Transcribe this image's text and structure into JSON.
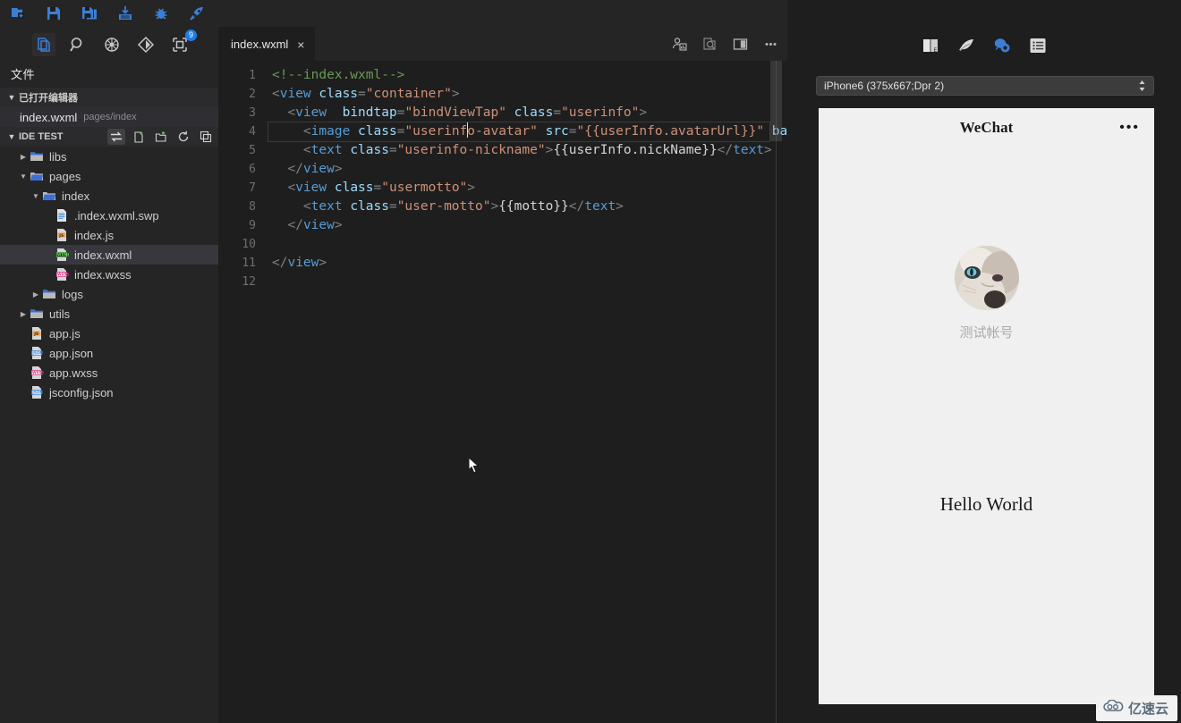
{
  "window": {
    "title_bar_icons": [
      {
        "name": "new-file-icon",
        "glyph": "new-file"
      },
      {
        "name": "save-icon",
        "glyph": "save"
      },
      {
        "name": "save-all-icon",
        "glyph": "save-all"
      },
      {
        "name": "upload-icon",
        "glyph": "upload"
      },
      {
        "name": "debug-bug-icon",
        "glyph": "bug"
      },
      {
        "name": "preview-rocket-icon",
        "glyph": "rocket"
      }
    ],
    "panel_toggles": [
      {
        "name": "toggle-left-panel",
        "state": "active"
      },
      {
        "name": "toggle-bottom-panel",
        "state": "inactive"
      },
      {
        "name": "toggle-right-panel",
        "state": "active"
      }
    ]
  },
  "activity_bar": {
    "items": [
      {
        "name": "explorer-icon",
        "label": "Explorer",
        "active": true,
        "badge": ""
      },
      {
        "name": "search-icon",
        "label": "Search",
        "active": false,
        "badge": ""
      },
      {
        "name": "debug-icon",
        "label": "Debug",
        "active": false,
        "badge": ""
      },
      {
        "name": "source-control-icon",
        "label": "Source Control",
        "active": false,
        "badge": ""
      },
      {
        "name": "extensions-icon",
        "label": "Extensions",
        "active": false,
        "badge": "9"
      }
    ]
  },
  "sidebar": {
    "title": "文件",
    "open_editors": {
      "label": "已打开编辑器",
      "expanded": true,
      "items": [
        {
          "name": "index.wxml",
          "path": "pages/index",
          "active": true
        }
      ]
    },
    "project": {
      "label": "IDE TEST",
      "expanded": true,
      "actions": [
        {
          "name": "collapse-expand-icon",
          "highlight": true
        },
        {
          "name": "new-file-icon",
          "highlight": false
        },
        {
          "name": "new-folder-icon",
          "highlight": false
        },
        {
          "name": "refresh-icon",
          "highlight": false
        },
        {
          "name": "collapse-all-icon",
          "highlight": false
        }
      ]
    },
    "tree": [
      {
        "label": "libs",
        "type": "folder",
        "indent": 1,
        "expanded": false,
        "selected": false
      },
      {
        "label": "pages",
        "type": "folder",
        "indent": 1,
        "expanded": true,
        "selected": false
      },
      {
        "label": "index",
        "type": "folder",
        "indent": 2,
        "expanded": true,
        "selected": false
      },
      {
        "label": ".index.wxml.swp",
        "type": "swp",
        "indent": 3,
        "expanded": null,
        "selected": false
      },
      {
        "label": "index.js",
        "type": "js",
        "indent": 3,
        "expanded": null,
        "selected": false
      },
      {
        "label": "index.wxml",
        "type": "wxml",
        "indent": 3,
        "expanded": null,
        "selected": true
      },
      {
        "label": "index.wxss",
        "type": "wxss",
        "indent": 3,
        "expanded": null,
        "selected": false
      },
      {
        "label": "logs",
        "type": "folder",
        "indent": 2,
        "expanded": false,
        "selected": false
      },
      {
        "label": "utils",
        "type": "folder",
        "indent": 1,
        "expanded": false,
        "selected": false
      },
      {
        "label": "app.js",
        "type": "js",
        "indent": 1,
        "expanded": null,
        "selected": false
      },
      {
        "label": "app.json",
        "type": "json",
        "indent": 1,
        "expanded": null,
        "selected": false
      },
      {
        "label": "app.wxss",
        "type": "wxss",
        "indent": 1,
        "expanded": null,
        "selected": false
      },
      {
        "label": "jsconfig.json",
        "type": "json",
        "indent": 1,
        "expanded": null,
        "selected": false
      }
    ]
  },
  "editor": {
    "tabs": [
      {
        "label": "index.wxml",
        "active": true,
        "close_label": "×"
      }
    ],
    "actions": [
      {
        "name": "compile-preview-icon"
      },
      {
        "name": "search-in-file-icon"
      },
      {
        "name": "split-editor-icon"
      },
      {
        "name": "more-actions-icon"
      }
    ],
    "line_numbers": [
      "1",
      "2",
      "3",
      "4",
      "5",
      "6",
      "7",
      "8",
      "9",
      "10",
      "11",
      "12"
    ],
    "code_lines": [
      {
        "n": 1,
        "indent": 0,
        "cursor": false,
        "tokens": [
          {
            "t": "com",
            "v": "<!--index.wxml-->"
          }
        ]
      },
      {
        "n": 2,
        "indent": 0,
        "cursor": false,
        "tokens": [
          {
            "t": "punc",
            "v": "<"
          },
          {
            "t": "tag",
            "v": "view"
          },
          {
            "t": "plain",
            "v": " "
          },
          {
            "t": "attr",
            "v": "class"
          },
          {
            "t": "punc",
            "v": "="
          },
          {
            "t": "str",
            "v": "\"container\""
          },
          {
            "t": "punc",
            "v": ">"
          }
        ]
      },
      {
        "n": 3,
        "indent": 1,
        "cursor": false,
        "tokens": [
          {
            "t": "punc",
            "v": "<"
          },
          {
            "t": "tag",
            "v": "view"
          },
          {
            "t": "plain",
            "v": "  "
          },
          {
            "t": "attr",
            "v": "bindtap"
          },
          {
            "t": "punc",
            "v": "="
          },
          {
            "t": "str",
            "v": "\"bindViewTap\""
          },
          {
            "t": "plain",
            "v": " "
          },
          {
            "t": "attr",
            "v": "class"
          },
          {
            "t": "punc",
            "v": "="
          },
          {
            "t": "str",
            "v": "\"userinfo\""
          },
          {
            "t": "punc",
            "v": ">"
          }
        ]
      },
      {
        "n": 4,
        "indent": 2,
        "cursor": true,
        "tokens": [
          {
            "t": "punc",
            "v": "<"
          },
          {
            "t": "tag",
            "v": "image"
          },
          {
            "t": "plain",
            "v": " "
          },
          {
            "t": "attr",
            "v": "class"
          },
          {
            "t": "punc",
            "v": "="
          },
          {
            "t": "str",
            "v": "\"userinf"
          },
          {
            "t": "caret",
            "v": ""
          },
          {
            "t": "str",
            "v": "o-avatar\""
          },
          {
            "t": "plain",
            "v": " "
          },
          {
            "t": "attr",
            "v": "src"
          },
          {
            "t": "punc",
            "v": "="
          },
          {
            "t": "str",
            "v": "\"{{userInfo.avatarUrl}}\""
          },
          {
            "t": "plain",
            "v": " "
          },
          {
            "t": "attr",
            "v": "bac"
          }
        ]
      },
      {
        "n": 5,
        "indent": 2,
        "cursor": false,
        "tokens": [
          {
            "t": "punc",
            "v": "<"
          },
          {
            "t": "tag",
            "v": "text"
          },
          {
            "t": "plain",
            "v": " "
          },
          {
            "t": "attr",
            "v": "class"
          },
          {
            "t": "punc",
            "v": "="
          },
          {
            "t": "str",
            "v": "\"userinfo-nickname\""
          },
          {
            "t": "punc",
            "v": ">"
          },
          {
            "t": "mus",
            "v": "{{userInfo.nickName}}"
          },
          {
            "t": "punc",
            "v": "</"
          },
          {
            "t": "tag",
            "v": "text"
          },
          {
            "t": "punc",
            "v": ">"
          }
        ]
      },
      {
        "n": 6,
        "indent": 1,
        "cursor": false,
        "tokens": [
          {
            "t": "punc",
            "v": "</"
          },
          {
            "t": "tag",
            "v": "view"
          },
          {
            "t": "punc",
            "v": ">"
          }
        ]
      },
      {
        "n": 7,
        "indent": 1,
        "cursor": false,
        "tokens": [
          {
            "t": "punc",
            "v": "<"
          },
          {
            "t": "tag",
            "v": "view"
          },
          {
            "t": "plain",
            "v": " "
          },
          {
            "t": "attr",
            "v": "class"
          },
          {
            "t": "punc",
            "v": "="
          },
          {
            "t": "str",
            "v": "\"usermotto\""
          },
          {
            "t": "punc",
            "v": ">"
          }
        ]
      },
      {
        "n": 8,
        "indent": 2,
        "cursor": false,
        "tokens": [
          {
            "t": "punc",
            "v": "<"
          },
          {
            "t": "tag",
            "v": "text"
          },
          {
            "t": "plain",
            "v": " "
          },
          {
            "t": "attr",
            "v": "class"
          },
          {
            "t": "punc",
            "v": "="
          },
          {
            "t": "str",
            "v": "\"user-motto\""
          },
          {
            "t": "punc",
            "v": ">"
          },
          {
            "t": "mus",
            "v": "{{motto}}"
          },
          {
            "t": "punc",
            "v": "</"
          },
          {
            "t": "tag",
            "v": "text"
          },
          {
            "t": "punc",
            "v": ">"
          }
        ]
      },
      {
        "n": 9,
        "indent": 1,
        "cursor": false,
        "tokens": [
          {
            "t": "punc",
            "v": "</"
          },
          {
            "t": "tag",
            "v": "view"
          },
          {
            "t": "punc",
            "v": ">"
          }
        ]
      },
      {
        "n": 10,
        "indent": 0,
        "cursor": false,
        "tokens": []
      },
      {
        "n": 11,
        "indent": 0,
        "cursor": false,
        "tokens": [
          {
            "t": "punc",
            "v": "</"
          },
          {
            "t": "tag",
            "v": "view"
          },
          {
            "t": "punc",
            "v": ">"
          }
        ]
      },
      {
        "n": 12,
        "indent": 0,
        "cursor": false,
        "tokens": []
      }
    ]
  },
  "simulator": {
    "toolbar": [
      {
        "name": "page-path-icon"
      },
      {
        "name": "feather-clear-icon"
      },
      {
        "name": "wechat-eye-icon"
      },
      {
        "name": "list-menu-icon"
      }
    ],
    "device": {
      "selected": "iPhone6 (375x667;Dpr 2)"
    },
    "phone": {
      "nav_title": "WeChat",
      "more_dots": "•••",
      "nickname": "测试帐号",
      "motto": "Hello World"
    }
  },
  "watermark": {
    "text": "亿速云"
  }
}
